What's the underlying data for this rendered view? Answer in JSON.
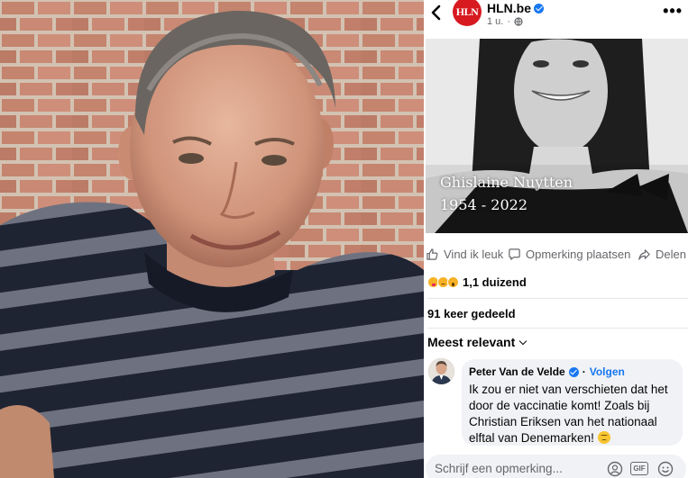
{
  "post": {
    "page_name": "HLN.be",
    "logo_text": "HLN",
    "time": "1 u.",
    "image": {
      "name": "Ghislaine Nuytten",
      "years": "1954 - 2022"
    },
    "actions": {
      "like": "Vind ik leuk",
      "comment": "Opmerking plaatsen",
      "share": "Delen"
    },
    "reactions_count": "1,1 duizend",
    "shares": "91 keer gedeeld",
    "sort_label": "Meest relevant"
  },
  "comment": {
    "author": "Peter Van de Velde",
    "follow": "Volgen",
    "text": "Ik zou er niet van verschieten dat het door de vaccinatie komt! Zoals bij Christian Eriksen van het nationaal elftal van Denemarken!"
  },
  "composer": {
    "placeholder": "Schrijf een opmerking..."
  },
  "colors": {
    "accent": "#1877f2",
    "brand": "#d71920",
    "muted": "#65676b"
  }
}
